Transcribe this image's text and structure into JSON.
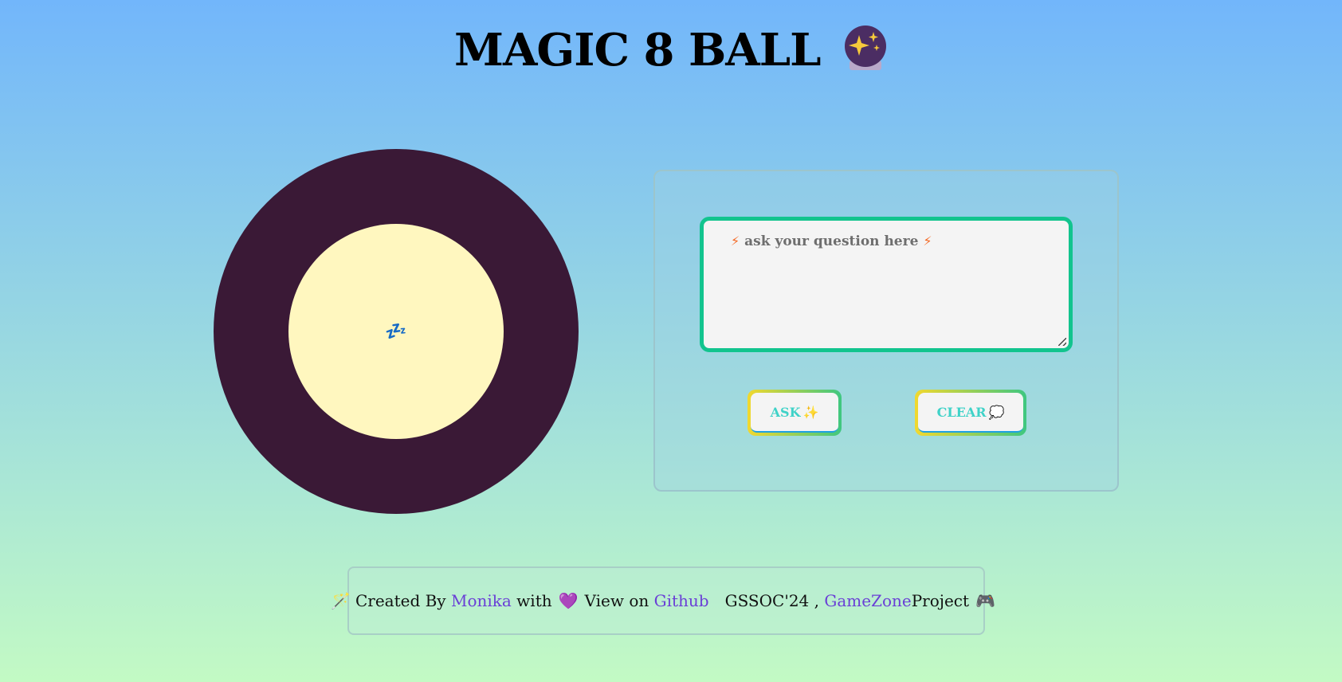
{
  "header": {
    "title": "MAGIC 8 BALL",
    "title_icon": "crystal-ball-icon"
  },
  "ball": {
    "answer_text": "💤",
    "outer_color": "#3a1936",
    "inner_color": "#fff7bf"
  },
  "form": {
    "placeholder_text": "ask your question here",
    "bolt_icon": "⚡",
    "ask_label": "ASK",
    "ask_emoji": "✨",
    "clear_label": "CLEAR",
    "clear_emoji": "💭",
    "accent_color": "#12c48e"
  },
  "footer": {
    "wand_icon": "🪄",
    "created_by": "Created By",
    "author": "Monika",
    "with": "with",
    "heart_icon": "💜",
    "view_on": "View on",
    "github": "Github",
    "gssoc": "GSSOC'24 ,",
    "gamezone": "GameZone",
    "project": "Project",
    "controller_icon": "🎮"
  }
}
